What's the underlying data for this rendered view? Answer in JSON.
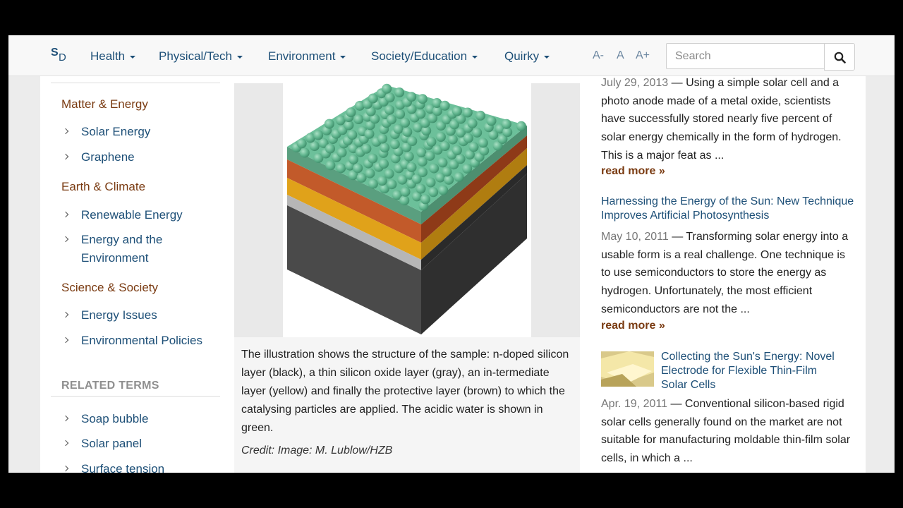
{
  "logo": {
    "s": "S",
    "d": "D"
  },
  "nav": {
    "items": [
      {
        "label": "Health"
      },
      {
        "label": "Physical/Tech"
      },
      {
        "label": "Environment"
      },
      {
        "label": "Society/Education"
      },
      {
        "label": "Quirky"
      }
    ],
    "font_controls": [
      "A-",
      "A",
      "A+"
    ],
    "search": {
      "placeholder": "Search"
    }
  },
  "sidebar": {
    "categories": [
      {
        "name": "Matter & Energy",
        "items": [
          "Solar Energy",
          "Graphene"
        ]
      },
      {
        "name": "Earth & Climate",
        "items": [
          "Renewable Energy",
          "Energy and the Environment"
        ]
      },
      {
        "name": "Science & Society",
        "items": [
          "Energy Issues",
          "Environmental Policies"
        ]
      }
    ],
    "related_terms_heading": "RELATED TERMS",
    "related_terms": [
      "Soap bubble",
      "Solar panel",
      "Surface tension"
    ]
  },
  "figure": {
    "caption": "The illustration shows the structure of the sample: n-doped silicon layer (black), a thin silicon oxide layer (gray), an in-termediate layer (yellow) and finally the protective layer (brown) to which the catalysing particles are applied. The acidic water is shown in green.",
    "credit": "Credit: Image: M. Lublow/HZB"
  },
  "related_stories": [
    {
      "title": "",
      "date": "July 29, 2013",
      "summary": "Using a simple solar cell and a photo anode made of a metal oxide, scientists have successfully stored nearly five percent of solar energy chemically in the form of hydrogen. This is a major feat as ...",
      "read_more": "read more »"
    },
    {
      "title": "Harnessing the Energy of the Sun: New Technique Improves Artificial Photosynthesis",
      "date": "May 10, 2011",
      "summary": "Transforming solar energy into a usable form is a real challenge. One technique is to use semiconductors to store the energy as hydrogen. Unfortunately, the most efficient semiconductors are not the ...",
      "read_more": "read more »"
    },
    {
      "title": "Collecting the Sun's Energy: Novel Electrode for Flexible Thin-Film Solar Cells",
      "date": "Apr. 19, 2011",
      "summary": "Conventional silicon-based rigid solar cells generally found on the market are not suitable for manufacturing moldable thin-film solar cells, in which a ..."
    }
  ],
  "colors": {
    "link": "#1d4f77",
    "category": "#7a3b12",
    "water_green": "#5fb48d",
    "layer_brown": "#c25a2a",
    "layer_yellow": "#e0a21a",
    "layer_gray": "#b6b6b6",
    "layer_black": "#3a3a3a"
  },
  "icons": {
    "search": "search-icon",
    "chevron": "chevron-right-icon",
    "caret": "caret-down-icon"
  }
}
